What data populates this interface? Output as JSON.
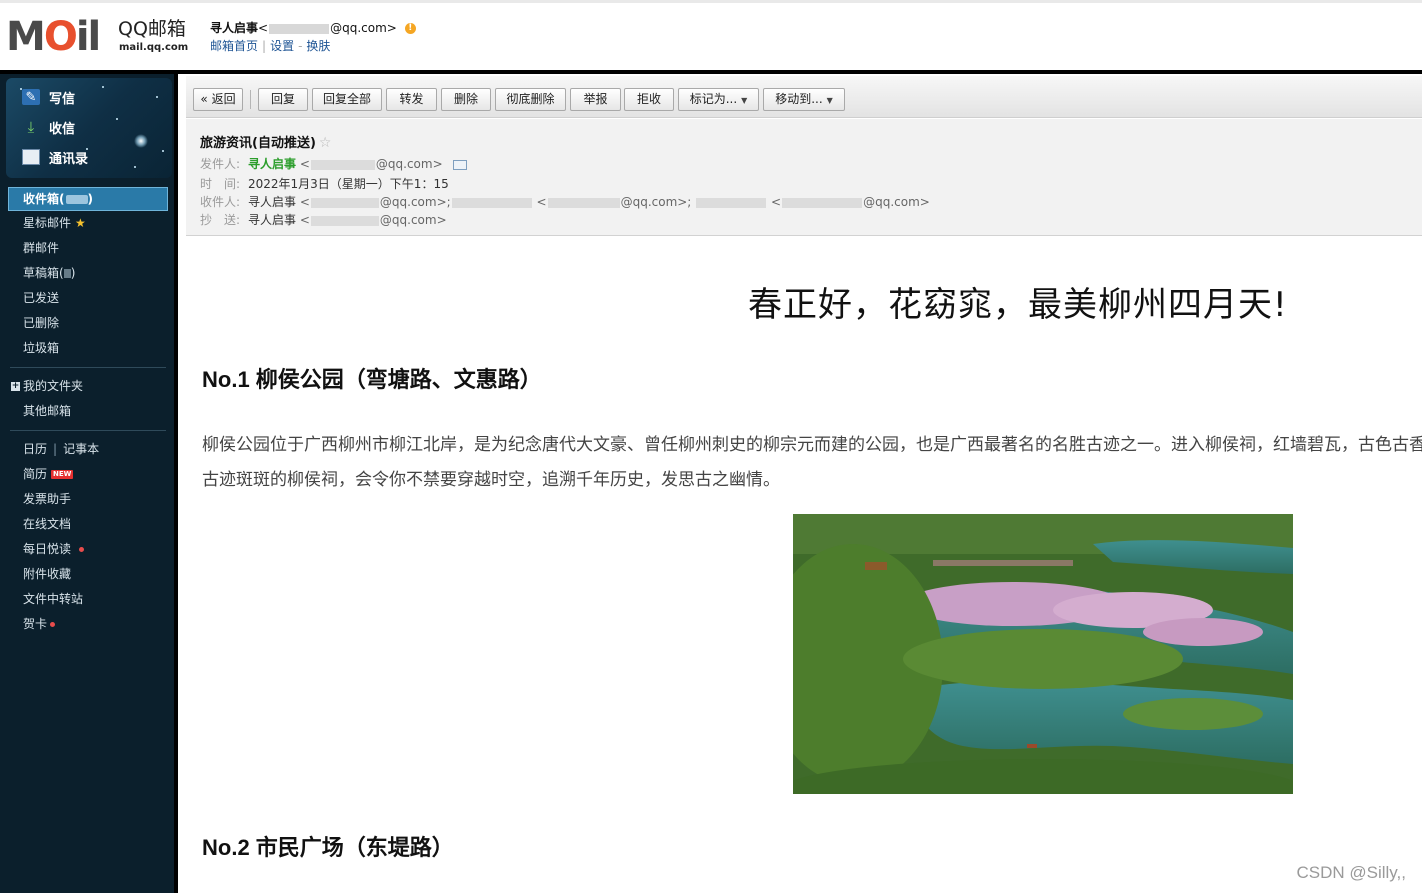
{
  "header": {
    "logo_text": "MOil",
    "brand": "QQ邮箱",
    "domain": "mail.qq.com",
    "account_name": "寻人启事",
    "account_email_prefix": "<",
    "account_email_suffix": "@qq.com>",
    "warn_icon": "!",
    "links": {
      "home": "邮箱首页",
      "settings": "设置",
      "skin": "换肤"
    }
  },
  "sidebar": {
    "quick": {
      "write": "写信",
      "receive": "收信",
      "contacts": "通讯录"
    },
    "folders": {
      "inbox": "收件箱(",
      "inbox_close": ")",
      "starred": "星标邮件",
      "group": "群邮件",
      "drafts": "草稿箱(",
      "drafts_close": ")",
      "sent": "已发送",
      "deleted": "已删除",
      "trash": "垃圾箱",
      "my_folders": "我的文件夹",
      "other_mail": "其他邮箱"
    },
    "tools": {
      "calendar": "日历",
      "notes": "记事本",
      "resume": "简历",
      "resume_badge": "NEW",
      "invoice": "发票助手",
      "docs": "在线文档",
      "daily": "每日悦读",
      "attachments": "附件收藏",
      "transfer": "文件中转站",
      "cards": "贺卡"
    }
  },
  "toolbar": {
    "back": "« 返回",
    "reply": "回复",
    "reply_all": "回复全部",
    "forward": "转发",
    "delete": "删除",
    "delete_perm": "彻底删除",
    "report": "举报",
    "reject": "拒收",
    "mark_as": "标记为...",
    "move_to": "移动到..."
  },
  "mail": {
    "subject": "旅游资讯(自动推送)",
    "fav_star": "☆",
    "labels": {
      "from": "发件人:",
      "time": "时　间:",
      "to": "收件人:",
      "cc": "抄　送:"
    },
    "sender_name": "寻人启事",
    "lt": "<",
    "sender_suffix": "@qq.com>",
    "time": "2022年1月3日（星期一）下午1：15",
    "to_name": "寻人启事",
    "to_first_suffix": "@qq.com>;",
    "to_second_suffix": "@qq.com>;",
    "to_third_suffix": "@qq.com>",
    "cc_name": "寻人启事",
    "cc_suffix": "@qq.com>"
  },
  "content": {
    "headline": "春正好，花窈窕，最美柳州四月天!",
    "section1_title": "No.1 柳侯公园（弯塘路、文惠路）",
    "section1_text": "柳侯公园位于广西柳州市柳江北岸，是为纪念唐代大文豪、曾任柳州刺史的柳宗元而建的公园，也是广西最著名的名胜古迹之一。进入柳侯祠，红墙碧瓦，古色古香。在古迹斑斑的柳侯祠，会令你不禁要穿越时空，追溯千年历史，发思古之幽情。",
    "section2_title": "No.2 市民广场（东堤路）"
  },
  "watermark": "CSDN @Silly,,"
}
